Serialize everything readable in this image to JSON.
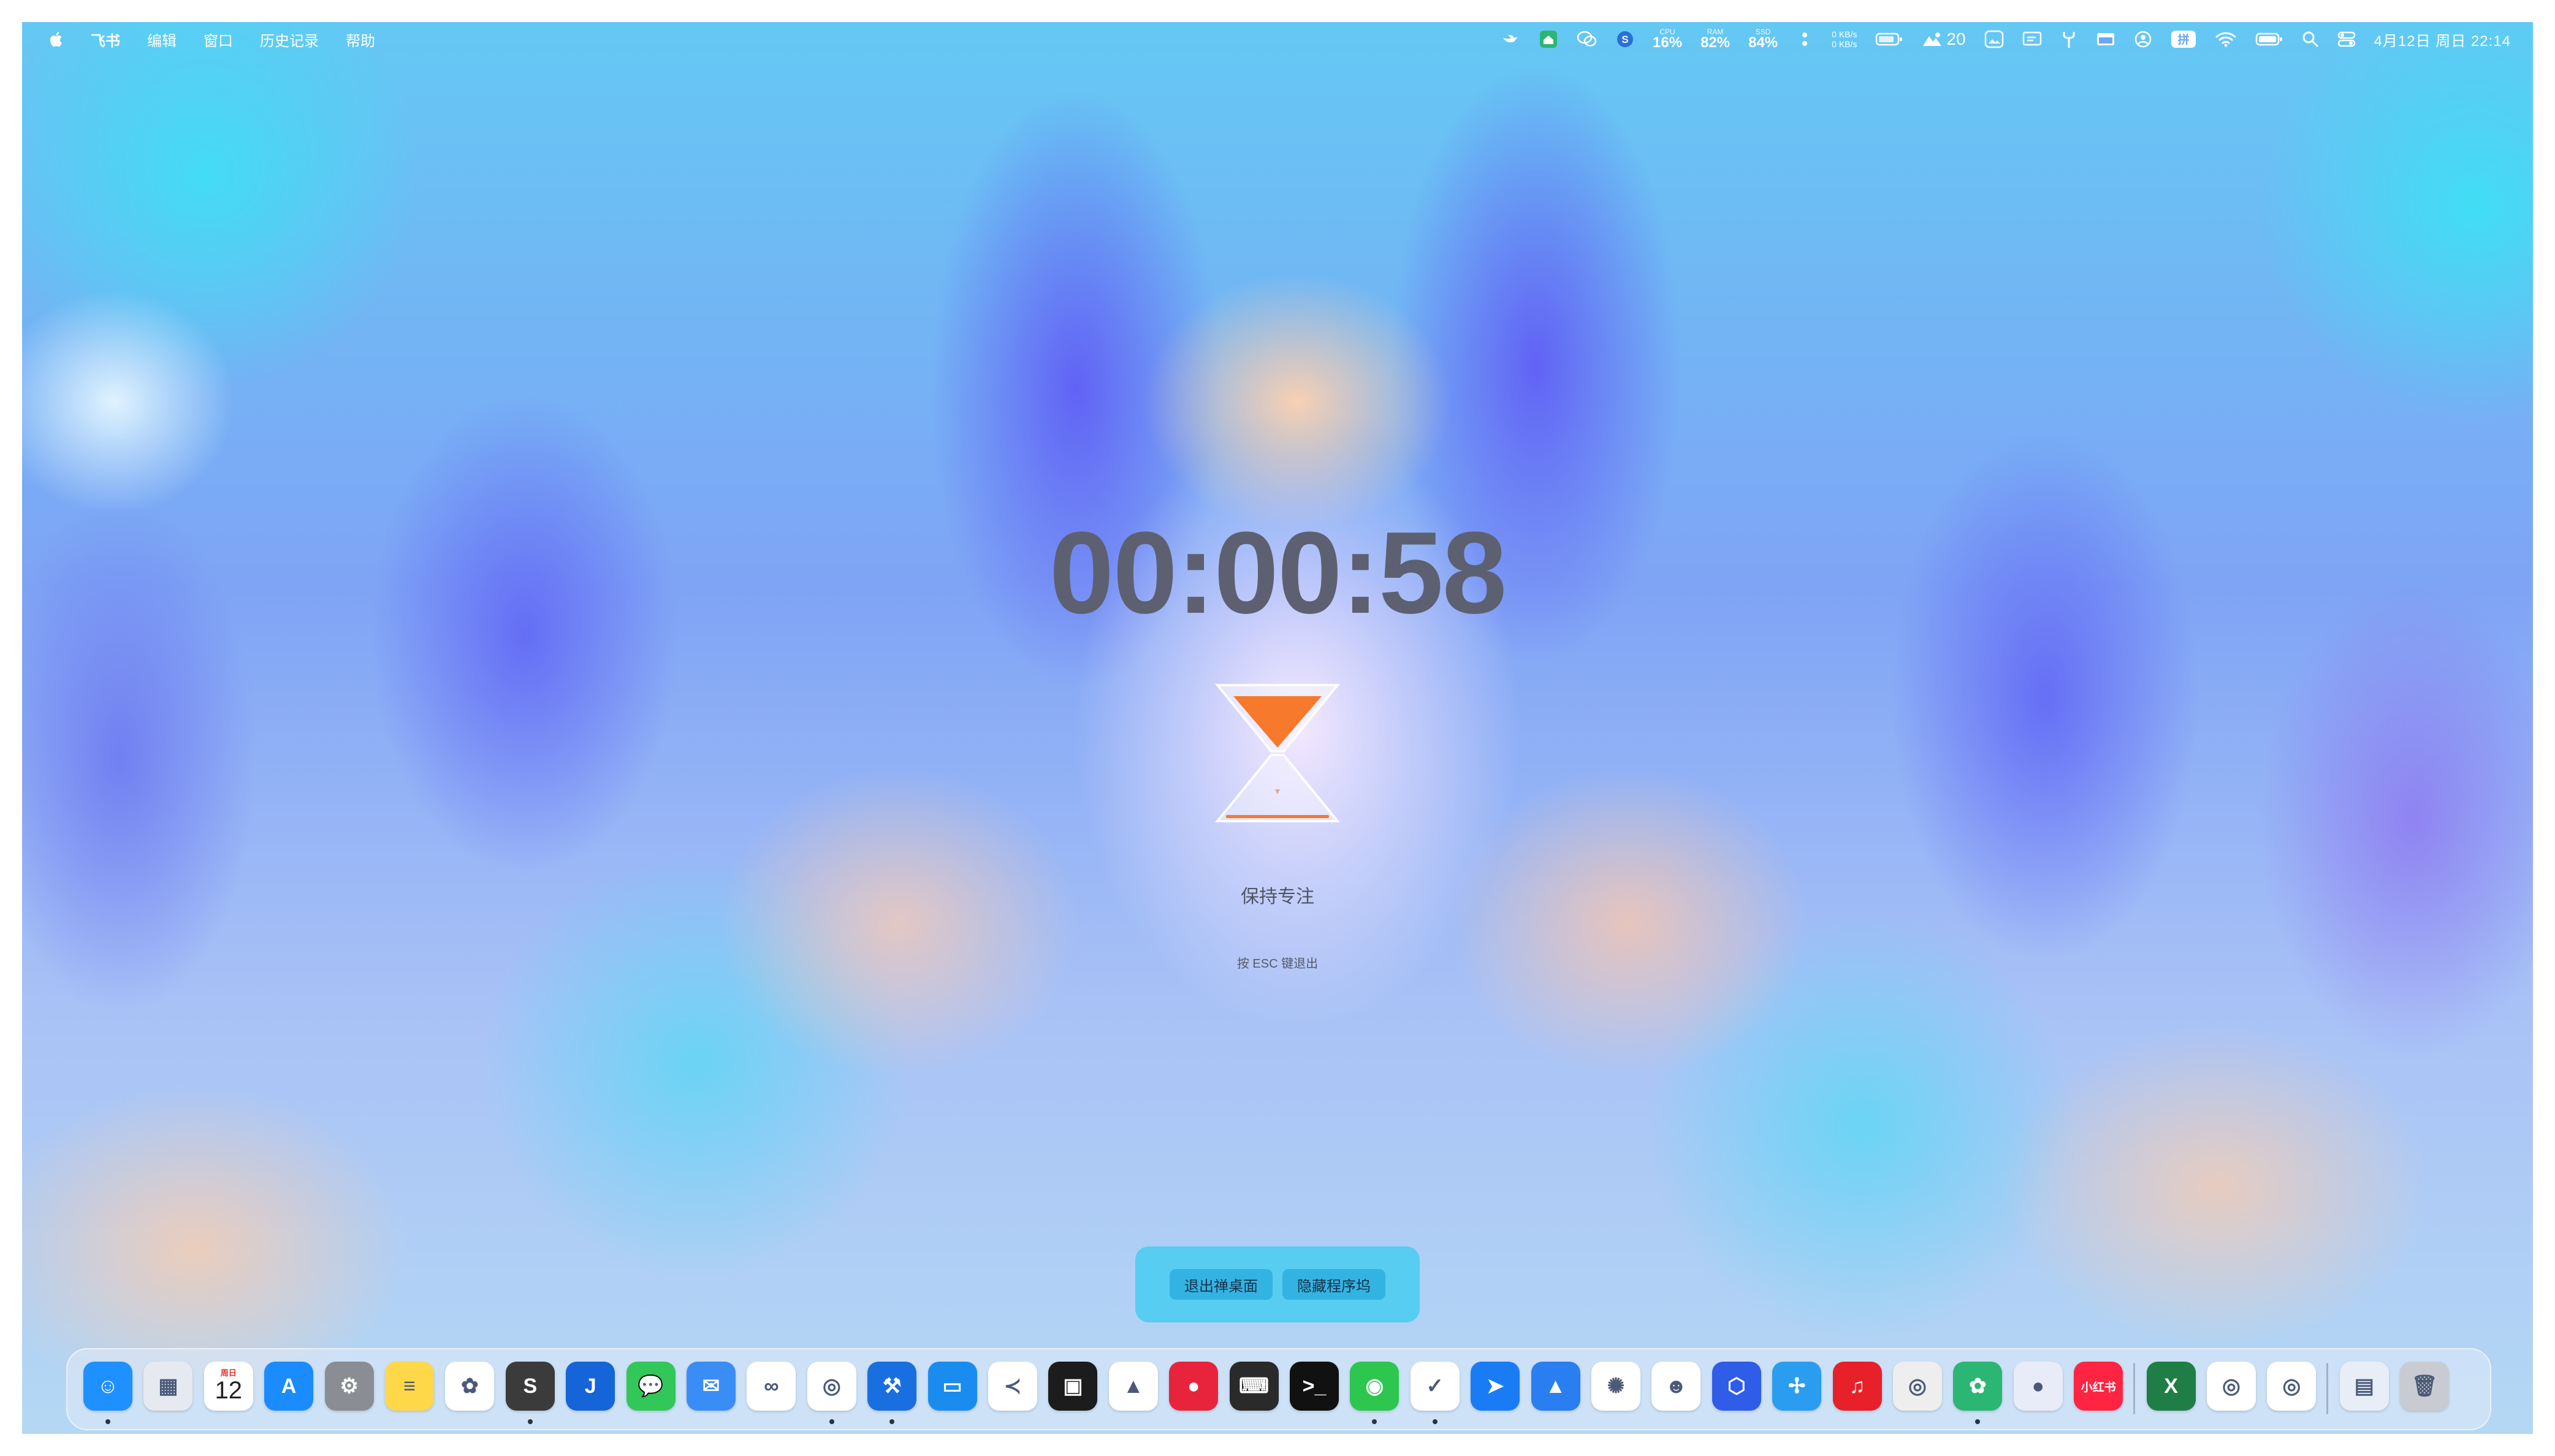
{
  "menubar": {
    "app_name": "飞书",
    "menus": [
      "编辑",
      "窗口",
      "历史记录",
      "帮助"
    ],
    "cpu": {
      "label": "CPU",
      "value": "16%"
    },
    "ram": {
      "label": "RAM",
      "value": "82%"
    },
    "ssd": {
      "label": "SSD",
      "value": "84%"
    },
    "net_up": "0 KB/s",
    "net_down": "0 KB/s",
    "weather_count": "20",
    "datetime": "4月12日 周日 22:14"
  },
  "focus": {
    "timer": "00:00:58",
    "message": "保持专注",
    "hint": "按 ESC 键退出",
    "hourglass_color": "#f7792c"
  },
  "panel": {
    "exit_label": "退出禅桌面",
    "hide_dock_label": "隐藏程序坞"
  },
  "dock": {
    "xhs_label": "小红书",
    "calendar_weekday": "周日",
    "calendar_day": "12",
    "apps": [
      {
        "name": "finder-icon",
        "color": "#1e90ff"
      },
      {
        "name": "launchpad-icon",
        "color": "#e6e9ef"
      },
      {
        "name": "calendar-icon",
        "color": "#ffffff"
      },
      {
        "name": "app-store-icon",
        "color": "#1a8cff"
      },
      {
        "name": "system-settings-icon",
        "color": "#8a8d93"
      },
      {
        "name": "notes-icon",
        "color": "#ffd84a"
      },
      {
        "name": "photos-icon",
        "color": "#ffffff"
      },
      {
        "name": "sublime-text-icon",
        "color": "#3b3b3b"
      },
      {
        "name": "j-app-icon",
        "color": "#1565d8"
      },
      {
        "name": "messages-icon",
        "color": "#31c759"
      },
      {
        "name": "mail-icon",
        "color": "#3a8df5"
      },
      {
        "name": "baidu-netdisk-icon",
        "color": "#ffffff"
      },
      {
        "name": "chrome-icon",
        "color": "#ffffff"
      },
      {
        "name": "xcode-hammer-icon",
        "color": "#1a6fe0"
      },
      {
        "name": "windows-app-icon",
        "color": "#1a8cf0"
      },
      {
        "name": "vscode-icon",
        "color": "#ffffff"
      },
      {
        "name": "terminal-green-icon",
        "color": "#1c1c1c"
      },
      {
        "name": "google-drive-icon",
        "color": "#ffffff"
      },
      {
        "name": "red-app-icon",
        "color": "#e8243c"
      },
      {
        "name": "keyboard-app-icon",
        "color": "#2a2a2a"
      },
      {
        "name": "terminal-icon",
        "color": "#111111"
      },
      {
        "name": "wechat-icon",
        "color": "#2dc64f"
      },
      {
        "name": "mail-check-icon",
        "color": "#ffffff"
      },
      {
        "name": "feishu-icon",
        "color": "#1a7cf5"
      },
      {
        "name": "mountain-app-icon",
        "color": "#2a7ef0"
      },
      {
        "name": "chatgpt-icon",
        "color": "#ffffff"
      },
      {
        "name": "avatar-app-icon",
        "color": "#ffffff"
      },
      {
        "name": "blue-hex-app-icon",
        "color": "#2f5de8"
      },
      {
        "name": "fan-app-icon",
        "color": "#2a9df0"
      },
      {
        "name": "netease-music-icon",
        "color": "#e8202a"
      },
      {
        "name": "record-app-icon",
        "color": "#eeeeee"
      },
      {
        "name": "green-app-icon",
        "color": "#2bb673"
      },
      {
        "name": "blue-blob-app-icon",
        "color": "#e8ecf8"
      },
      {
        "name": "xiaohongshu-icon",
        "color": "#ff2442"
      },
      {
        "name": "excel-icon",
        "color": "#1e7e45"
      },
      {
        "name": "chrome-icon-2",
        "color": "#ffffff"
      },
      {
        "name": "chrome-icon-3",
        "color": "#ffffff"
      },
      {
        "name": "documents-folder-icon",
        "color": "#e8eef8"
      },
      {
        "name": "trash-icon",
        "color": "#c8ccd2"
      }
    ]
  }
}
